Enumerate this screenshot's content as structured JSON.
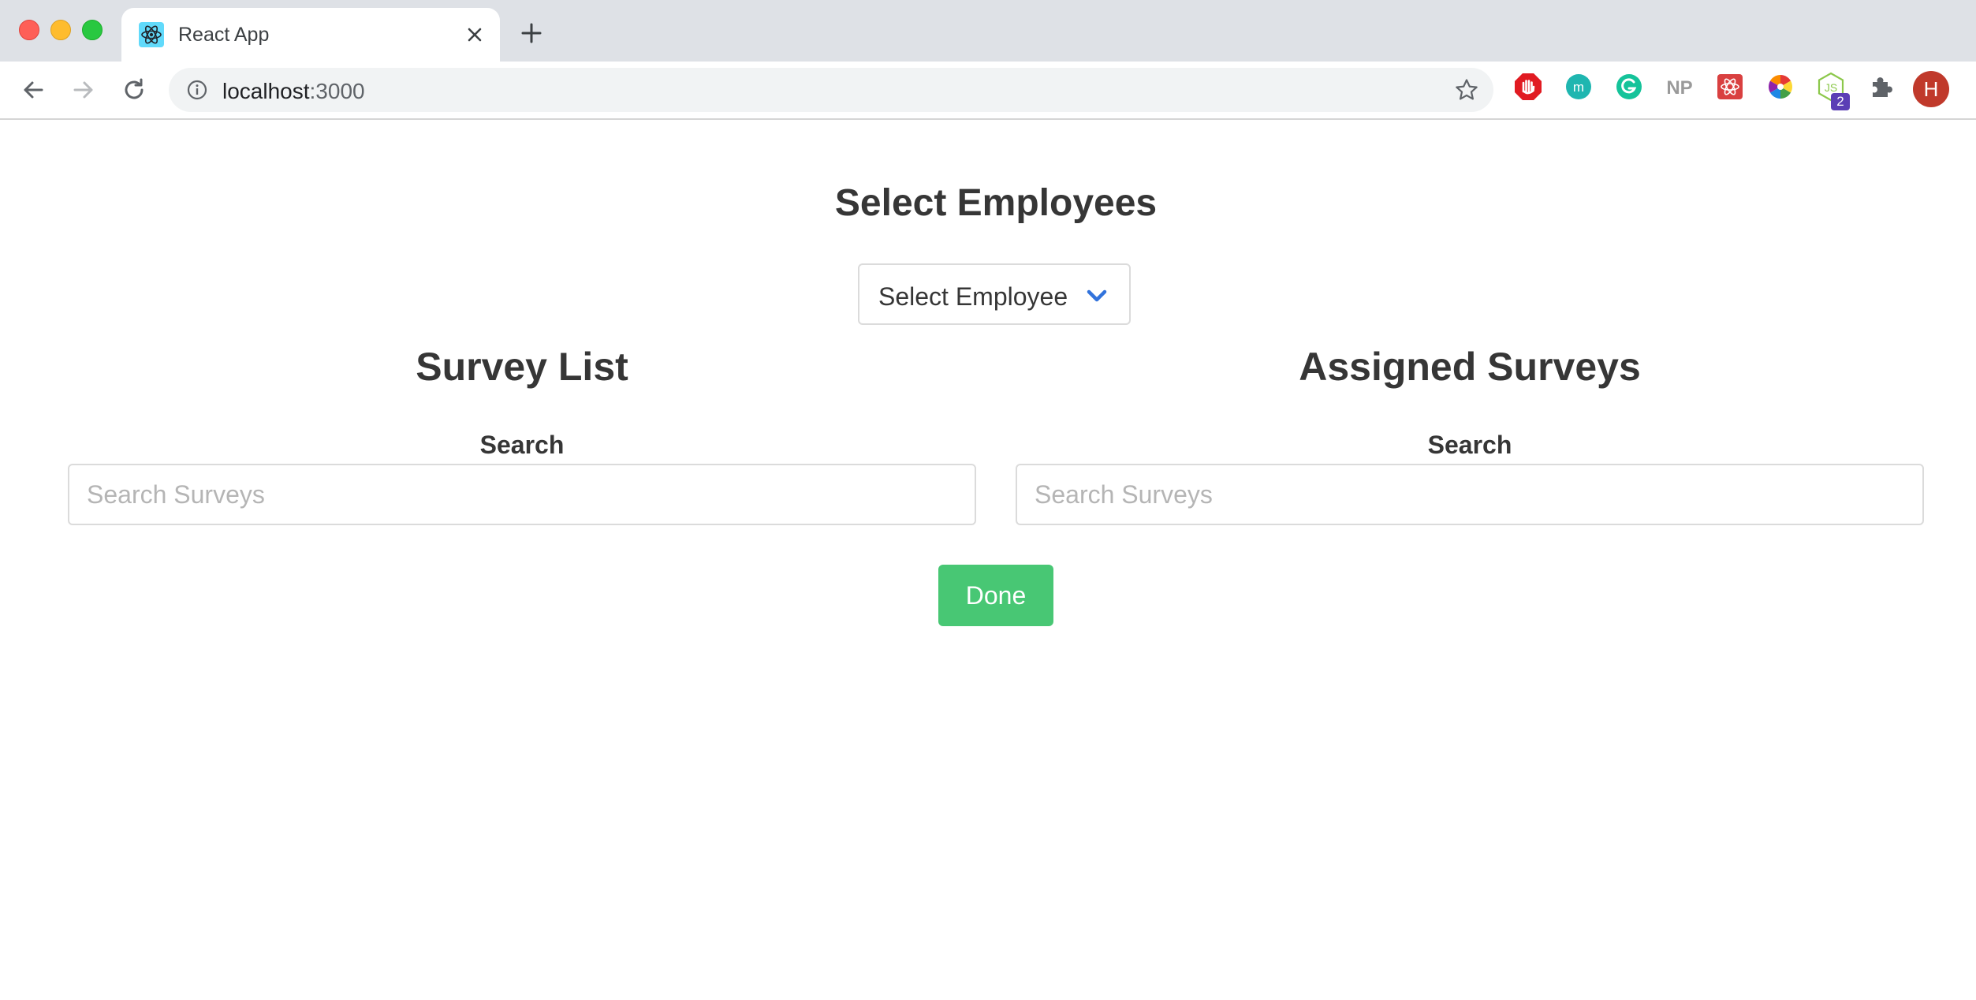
{
  "browser": {
    "tab_title": "React App",
    "url_host": "localhost",
    "url_port": ":3000",
    "avatar_initial": "H",
    "extension_badge": "2",
    "extensions": [
      "adblock-icon",
      "m-extension-icon",
      "grammarly-icon",
      "np-extension-icon",
      "react-devtools-icon",
      "color-picker-icon",
      "nodejs-icon",
      "puzzle-extensions-icon"
    ]
  },
  "page": {
    "title": "Select Employees",
    "employee_select": {
      "selected": "Select Employee"
    },
    "survey_list": {
      "title": "Survey List",
      "search_label": "Search",
      "search_placeholder": "Search Surveys"
    },
    "assigned_surveys": {
      "title": "Assigned Surveys",
      "search_label": "Search",
      "search_placeholder": "Search Surveys"
    },
    "done_label": "Done"
  },
  "colors": {
    "accent_green": "#48c774",
    "chevron_blue": "#3273dc",
    "text": "#363636"
  }
}
